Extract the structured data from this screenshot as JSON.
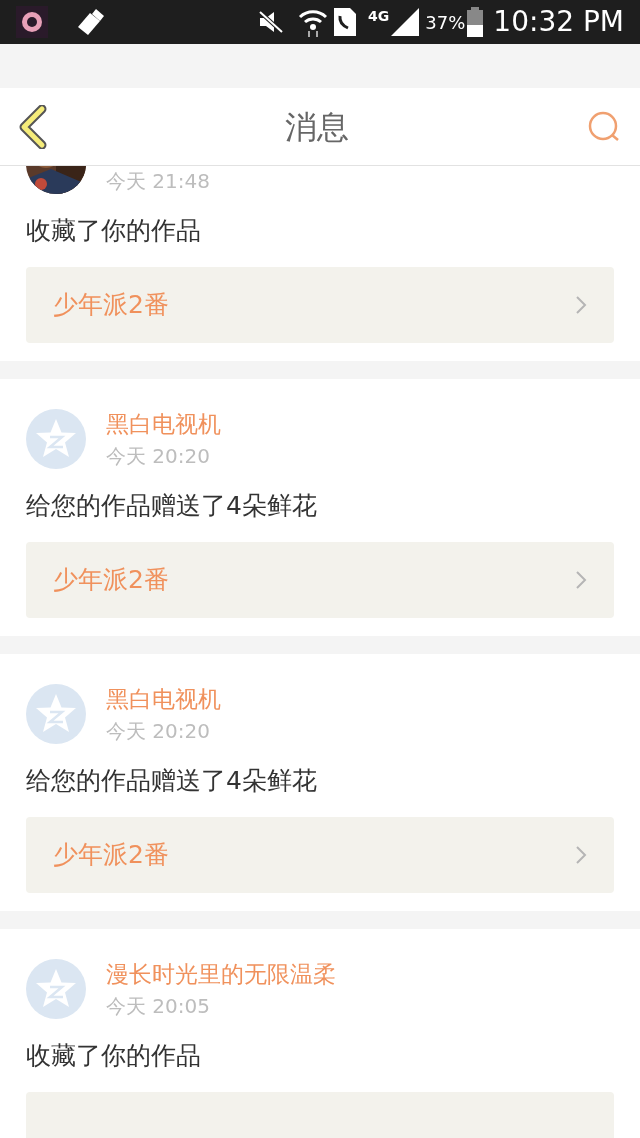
{
  "status_bar": {
    "network": "4G",
    "battery": "37%",
    "time": "10:32 PM"
  },
  "header": {
    "title": "消息"
  },
  "messages": [
    {
      "time": "今天 21:48",
      "text": "收藏了你的作品",
      "work": {
        "title": "少年派2番"
      }
    },
    {
      "avatar": {
        "kind": "default"
      },
      "name": "黑白电视机",
      "time": "今天 20:20",
      "text": "给您的作品赠送了4朵鲜花",
      "work": {
        "title": "少年派2番"
      }
    },
    {
      "avatar": {
        "kind": "default"
      },
      "name": "黑白电视机",
      "time": "今天 20:20",
      "text": "给您的作品赠送了4朵鲜花",
      "work": {
        "title": "少年派2番"
      }
    },
    {
      "avatar": {
        "kind": "default"
      },
      "name": "漫长时光里的无限温柔",
      "time": "今天 20:05",
      "text": "收藏了你的作品",
      "work": {
        "kind": "link"
      }
    }
  ]
}
